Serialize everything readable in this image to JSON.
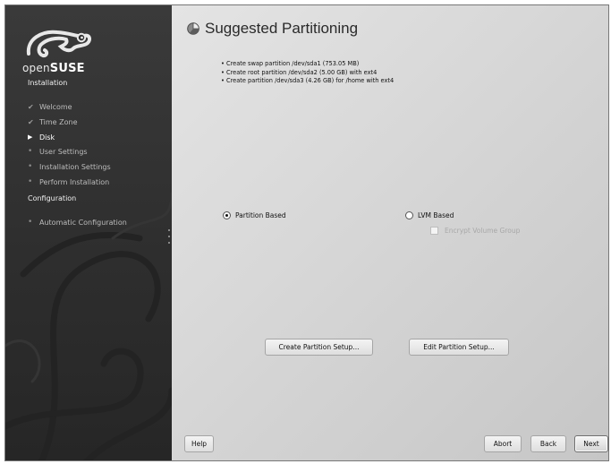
{
  "sidebar": {
    "brand_open": "open",
    "brand_suse": "SUSE",
    "installation_title": "Installation",
    "steps": [
      {
        "label": "Welcome",
        "state": "done",
        "mark": "✔"
      },
      {
        "label": "Time Zone",
        "state": "done",
        "mark": "✔"
      },
      {
        "label": "Disk",
        "state": "current",
        "mark": "▶"
      },
      {
        "label": "User Settings",
        "state": "pending",
        "mark": "•"
      },
      {
        "label": "Installation Settings",
        "state": "pending",
        "mark": "•"
      },
      {
        "label": "Perform Installation",
        "state": "pending",
        "mark": "•"
      }
    ],
    "configuration_title": "Configuration",
    "config_steps": [
      {
        "label": "Automatic Configuration",
        "state": "pending",
        "mark": "•"
      }
    ]
  },
  "main": {
    "title": "Suggested Partitioning",
    "title_icon": "partition-pie-icon",
    "summary": [
      "Create swap partition /dev/sda1 (753.05 MB)",
      "Create root partition /dev/sda2 (5.00 GB) with ext4",
      "Create partition /dev/sda3 (4.26 GB) for /home with ext4"
    ],
    "options": {
      "partition_based": {
        "label": "Partition Based",
        "selected": true
      },
      "lvm_based": {
        "label": "LVM Based",
        "selected": false
      },
      "encrypt_volume_group": {
        "label": "Encrypt Volume Group",
        "checked": false,
        "enabled": false
      }
    },
    "create_setup_button": "Create Partition Setup...",
    "edit_setup_button": "Edit Partition Setup..."
  },
  "footer": {
    "help_button": "Help",
    "abort_button": "Abort",
    "back_button": "Back",
    "next_button": "Next"
  },
  "colors": {
    "sidebar_bg": "#2e2e2e",
    "main_bg": "#d8d8d8",
    "button_border": "#a5a5a5"
  }
}
